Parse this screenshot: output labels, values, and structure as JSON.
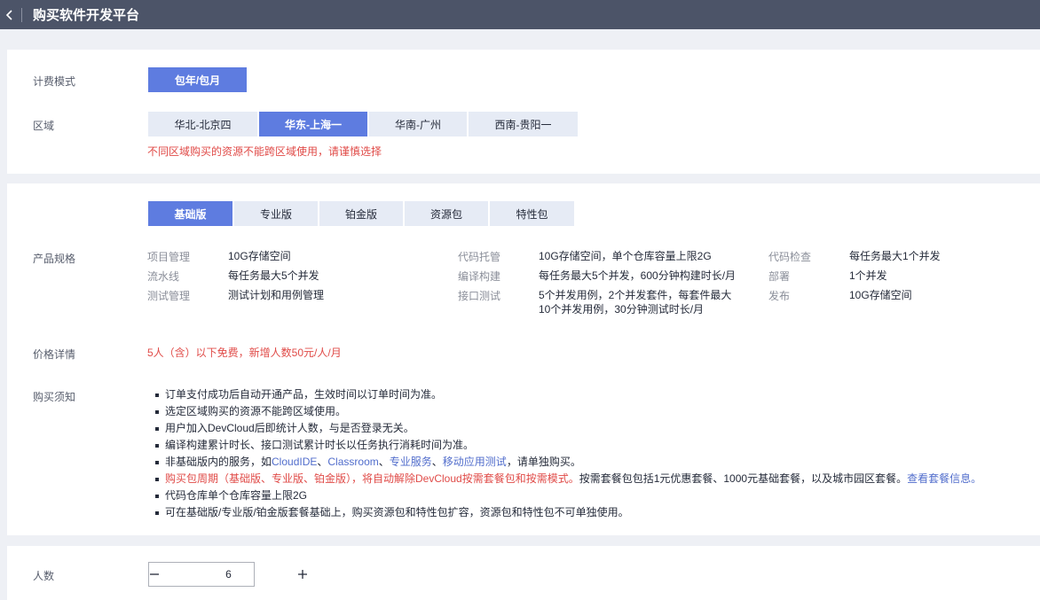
{
  "header": {
    "title": "购买软件开发平台"
  },
  "billing": {
    "label": "计费模式",
    "option": "包年/包月"
  },
  "region": {
    "label": "区域",
    "options": [
      "华北-北京四",
      "华东-上海一",
      "华南-广州",
      "西南-贵阳一"
    ],
    "selected": "华东-上海一",
    "warning": "不同区域购买的资源不能跨区域使用，请谨慎选择"
  },
  "editions": {
    "tabs": [
      "基础版",
      "专业版",
      "铂金版",
      "资源包",
      "特性包"
    ],
    "selected": "基础版"
  },
  "specs": {
    "label": "产品规格",
    "col1": [
      {
        "key": "项目管理",
        "value": "10G存储空间"
      },
      {
        "key": "流水线",
        "value": "每任务最大5个并发"
      },
      {
        "key": "测试管理",
        "value": "测试计划和用例管理"
      }
    ],
    "col2": [
      {
        "key": "代码托管",
        "value": "10G存储空间，单个仓库容量上限2G"
      },
      {
        "key": "编译构建",
        "value": "每任务最大5个并发，600分钟构建时长/月"
      },
      {
        "key": "接口测试",
        "value": "5个并发用例，2个并发套件，每套件最大",
        "value2": "10个并发用例，30分钟测试时长/月"
      }
    ],
    "col3": [
      {
        "key": "代码检查",
        "value": "每任务最大1个并发"
      },
      {
        "key": "部署",
        "value": "1个并发"
      },
      {
        "key": "发布",
        "value": "10G存储空间"
      }
    ]
  },
  "price": {
    "label": "价格详情",
    "text": "5人（含）以下免费，新增人数50元/人/月"
  },
  "notice": {
    "label": "购买须知",
    "item1": "订单支付成功后自动开通产品，生效时间以订单时间为准。",
    "item2": "选定区域购买的资源不能跨区域使用。",
    "item3": "用户加入DevCloud后即统计人数，与是否登录无关。",
    "item4": "编译构建累计时长、接口测试累计时长以任务执行消耗时间为准。",
    "item5": {
      "prefix": "非基础版内的服务，如",
      "link1": "CloudIDE",
      "sep1": "、",
      "link2": "Classroom",
      "sep2": "、",
      "link3": "专业服务",
      "sep3": "、",
      "link4": "移动应用测试",
      "suffix": "，请单独购买。"
    },
    "item6": {
      "red": "购买包周期（基础版、专业版、铂金版），将自动解除DevCloud按需套餐包和按需模式。",
      "normal": "按需套餐包包括1元优惠套餐、1000元基础套餐，以及城市园区套餐。",
      "link": "查看套餐信息。"
    },
    "item7": "代码仓库单个仓库容量上限2G",
    "item8": "可在基础版/专业版/铂金版套餐基础上，购买资源包和特性包扩容，资源包和特性包不可单独使用。"
  },
  "people": {
    "label": "人数",
    "value": "6"
  },
  "colors": {
    "accent": "#5e7ce0",
    "warning": "#e04b48",
    "link": "#526ecc",
    "header_bg": "#4c5468"
  },
  "icons": {
    "back": "chevron-left-icon",
    "minus": "minus-icon",
    "plus": "plus-icon"
  }
}
